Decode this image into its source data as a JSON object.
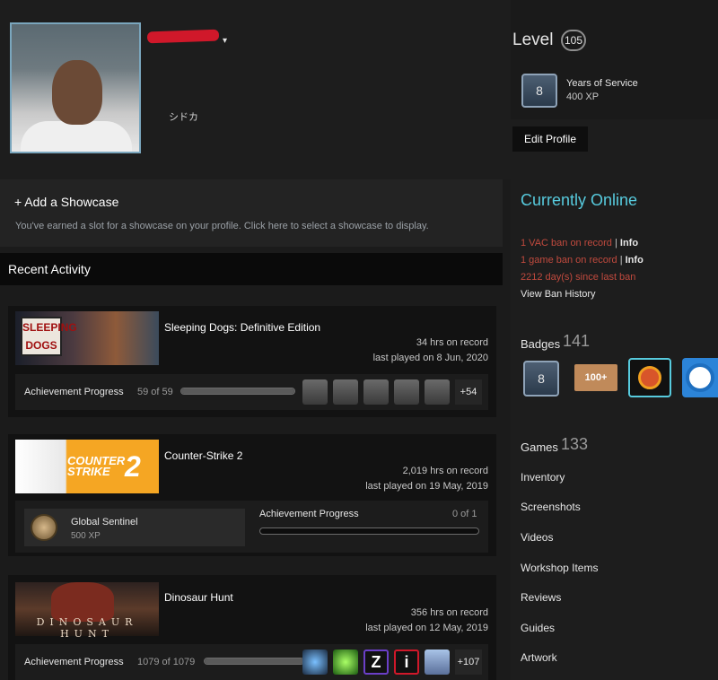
{
  "profile": {
    "real_name": "シドカ",
    "name_caret": "▾"
  },
  "level": {
    "label": "Level",
    "value": "105",
    "badge_years": "8",
    "badge_title": "Years of Service",
    "badge_xp": "400 XP",
    "edit_profile_label": "Edit Profile"
  },
  "showcase": {
    "title": "+ Add a Showcase",
    "description": "You've earned a slot for a showcase on your profile. Click here to select a showcase to display."
  },
  "status": {
    "online": "Currently Online",
    "bans": [
      {
        "text": "1 VAC ban on record",
        "sep": " | ",
        "link": "Info"
      },
      {
        "text": "1 game ban on record",
        "sep": " | ",
        "link": "Info"
      },
      {
        "text": "2212 day(s) since last ban"
      }
    ],
    "view_ban_history": "View Ban History"
  },
  "badges": {
    "label": "Badges",
    "count": "141",
    "items": [
      {
        "name": "years-of-service-badge",
        "text": "8"
      },
      {
        "name": "100-plus-badge",
        "text": "100+"
      },
      {
        "name": "sun-face-badge",
        "text": ""
      },
      {
        "name": "soccer-ball-badge",
        "text": ""
      }
    ]
  },
  "games": {
    "label": "Games",
    "count": "133"
  },
  "links": [
    "Inventory",
    "Screenshots",
    "Videos",
    "Workshop Items",
    "Reviews",
    "Guides",
    "Artwork"
  ],
  "recent_activity": {
    "title": "Recent Activity",
    "games": [
      {
        "name": "Sleeping Dogs: Definitive Edition",
        "capsule_text": "SLEEPING DOGS",
        "hours": "34 hrs on record",
        "last_played": "last played on 8 Jun, 2020",
        "ach_label": "Achievement Progress",
        "ach_count": "59 of 59",
        "ach_progress": 1.0,
        "ach_more": "+54"
      },
      {
        "name": "Counter-Strike 2",
        "capsule_text": "COUNTER STRIKE",
        "capsule_num": "2",
        "hours": "2,019 hrs on record",
        "last_played": "last played on 19 May, 2019",
        "rank_name": "Global Sentinel",
        "rank_xp": "500 XP",
        "ach_label": "Achievement Progress",
        "ach_count": "0 of 1",
        "ach_progress": 0.0
      },
      {
        "name": "Dinosaur Hunt",
        "capsule_text": "DINOSAUR HUNT",
        "hours": "356 hrs on record",
        "last_played": "last played on 12 May, 2019",
        "ach_label": "Achievement Progress",
        "ach_count": "1079 of 1079",
        "ach_progress": 1.0,
        "ach_more": "+107"
      }
    ]
  }
}
